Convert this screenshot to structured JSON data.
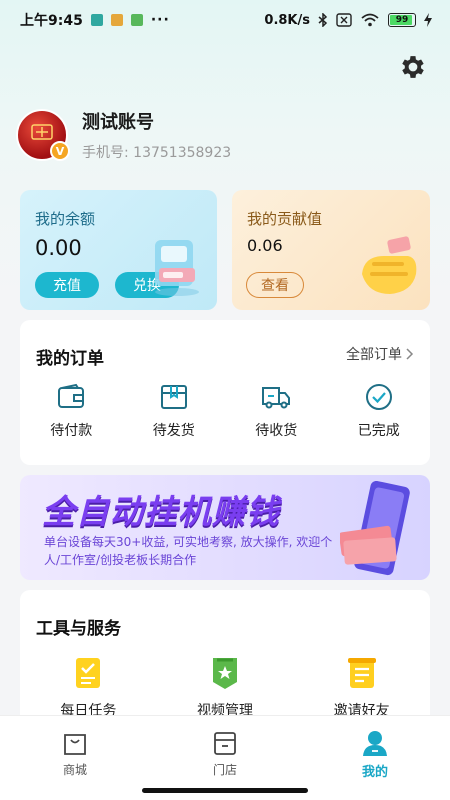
{
  "status_bar": {
    "time": "上午9:45",
    "dots": "···",
    "net_speed": "0.8K/s",
    "battery": "99"
  },
  "profile": {
    "account_name": "测试账号",
    "phone": "手机号: 13751358923"
  },
  "balance": {
    "title": "我的余额",
    "value": "0.00",
    "recharge_label": "充值",
    "exchange_label": "兑换"
  },
  "contribution": {
    "title": "我的贡献值",
    "value": "0.06",
    "view_label": "查看"
  },
  "orders": {
    "title": "我的订单",
    "all_label": "全部订单",
    "items": [
      {
        "label": "待付款",
        "icon": "wallet-icon"
      },
      {
        "label": "待发货",
        "icon": "package-icon"
      },
      {
        "label": "待收货",
        "icon": "truck-icon"
      },
      {
        "label": "已完成",
        "icon": "check-circle-icon"
      }
    ]
  },
  "banner": {
    "title": "全自动挂机赚钱",
    "text": "单台设备每天30+收益, 可实地考察, 放大操作, 欢迎个人/工作室/创投老板长期合作"
  },
  "tools": {
    "title": "工具与服务",
    "items": [
      {
        "label": "每日任务",
        "icon": "task-icon"
      },
      {
        "label": "视频管理",
        "icon": "video-badge-icon"
      },
      {
        "label": "邀请好友",
        "icon": "invite-icon"
      }
    ]
  },
  "nav": {
    "items": [
      {
        "label": "商城",
        "icon": "bag-icon"
      },
      {
        "label": "门店",
        "icon": "store-icon"
      },
      {
        "label": "我的",
        "icon": "user-icon"
      }
    ],
    "active": "我的"
  },
  "colors": {
    "accent": "#1aa7c6",
    "balance_button": "#1db7cf",
    "contribution_outline": "#d8893a",
    "banner_purple": "#7a3ef0"
  }
}
